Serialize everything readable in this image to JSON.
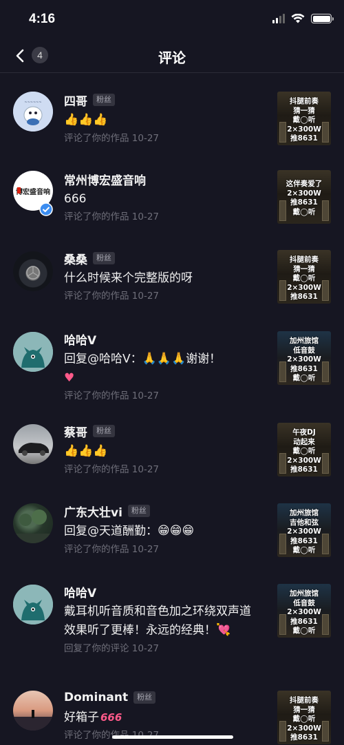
{
  "status": {
    "time": "4:16"
  },
  "nav": {
    "back_count": "4",
    "title": "评论"
  },
  "comments": [
    {
      "name": "四哥",
      "tag": "粉丝",
      "text": "",
      "emojis": "thumbs-up x3",
      "meta": "评论了你的作品  10-27",
      "thumb": [
        "抖腿前奏",
        "猜一猜",
        "戴◯听",
        "2×300W",
        "推8631"
      ]
    },
    {
      "name": "常州博宏盛音响",
      "tag": "",
      "text": "666",
      "meta": "评论了你的作品  10-27",
      "avatar_text": "博宏盛音响",
      "thumb": [
        "这伴奏爱了",
        "2×300W",
        "推8631",
        "戴◯听"
      ]
    },
    {
      "name": "桑桑",
      "tag": "粉丝",
      "text": "什么时候来个完整版的呀",
      "meta": "评论了你的作品  10-27",
      "thumb": [
        "抖腿前奏",
        "猜一猜",
        "戴◯听",
        "2×300W",
        "推8631"
      ]
    },
    {
      "name": "哈哈V",
      "tag": "",
      "text": "回复@哈哈V：",
      "text_after": "谢谢！",
      "meta": "评论了你的作品  10-27",
      "thumb": [
        "加州旅馆",
        "低音鼓",
        "2×300W",
        "推8631",
        "戴◯听"
      ]
    },
    {
      "name": "蔡哥",
      "tag": "粉丝",
      "text": "",
      "meta": "评论了你的作品  10-27",
      "thumb": [
        "午夜DJ",
        "动起来",
        "戴◯听",
        "2×300W",
        "推8631"
      ]
    },
    {
      "name": "广东大壮vi",
      "tag": "粉丝",
      "text": "回复@天道酬勤：",
      "meta": "评论了你的作品  10-27",
      "thumb": [
        "加州旅馆",
        "吉他和弦",
        "2×300W",
        "推8631",
        "戴◯听"
      ]
    },
    {
      "name": "哈哈V",
      "tag": "",
      "text": "戴耳机听音质和音色加之环绕双声道 效果听了更棒！永远的经典！",
      "meta": "回复了你的评论  10-27",
      "thumb": [
        "加州旅馆",
        "低音鼓",
        "2×300W",
        "推8631",
        "戴◯听"
      ]
    },
    {
      "name": "Dominant",
      "tag": "粉丝",
      "text": "好箱子",
      "text_after": "666",
      "meta": "评论了你的作品  10-27",
      "thumb": [
        "抖腿前奏",
        "猜一猜",
        "戴◯听",
        "2×300W",
        "推8631"
      ]
    }
  ]
}
